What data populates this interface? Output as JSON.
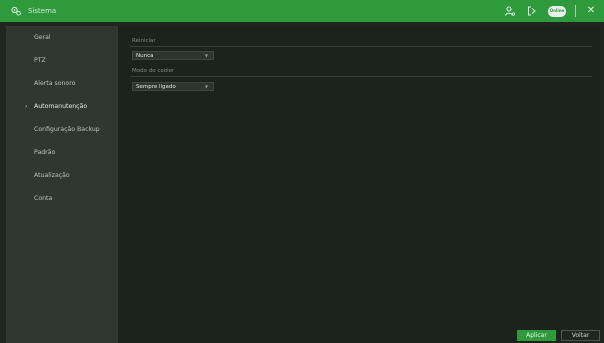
{
  "window": {
    "title": "Sistema",
    "title_icon": "gears-icon",
    "actions": [
      "user-icon",
      "logout-icon",
      "cloud-badge-icon",
      "close-icon"
    ],
    "badge_text": "Online",
    "close_glyph": "✕"
  },
  "sidebar": {
    "items": [
      {
        "label": "Geral",
        "active": false
      },
      {
        "label": "PTZ",
        "active": false
      },
      {
        "label": "Alerta sonoro",
        "active": false
      },
      {
        "label": "Automanutenção",
        "active": true
      },
      {
        "label": "Configuração Backup",
        "active": false
      },
      {
        "label": "Padrão",
        "active": false
      },
      {
        "label": "Atualização",
        "active": false
      },
      {
        "label": "Conta",
        "active": false
      }
    ],
    "active_marker": "›"
  },
  "form": {
    "reiniciar": {
      "label": "Reiniciar",
      "value": "Nunca"
    },
    "cooler": {
      "label": "Modo do cooler",
      "value": "Sempre ligado"
    }
  },
  "buttons": {
    "apply": "Aplicar",
    "back": "Voltar"
  },
  "colors": {
    "accent": "#2f9a3c",
    "sidebar_bg": "#2e3830",
    "content_bg": "#1c231d"
  }
}
